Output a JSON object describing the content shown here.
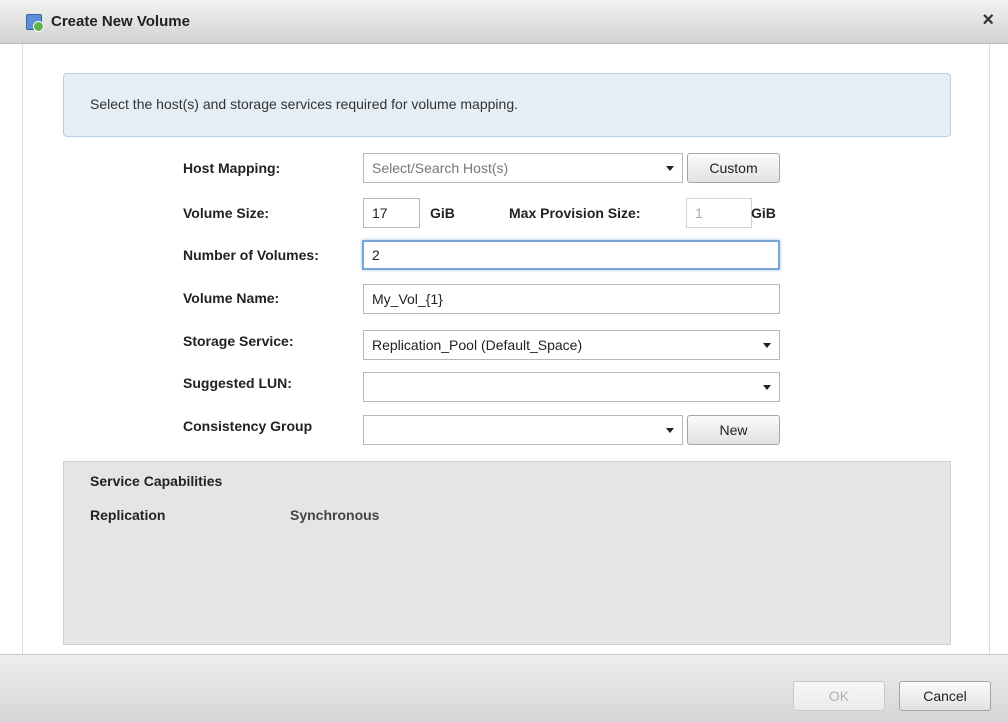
{
  "window": {
    "title": "Create New Volume",
    "close_symbol": "×",
    "title_icon": "create-volume-icon"
  },
  "info": {
    "text": "Select the host(s) and storage services required for volume mapping."
  },
  "form": {
    "host_mapping": {
      "label": "Host Mapping:",
      "placeholder": "Select/Search  Host(s)",
      "custom_label": "Custom"
    },
    "volume_size": {
      "label": "Volume Size:",
      "value": "17",
      "unit": "GiB",
      "max_label": "Max Provision Size:",
      "max_value": "1",
      "max_unit": "GiB"
    },
    "number_of_volumes": {
      "label": "Number of Volumes:",
      "value": "2"
    },
    "volume_name": {
      "label": "Volume Name:",
      "value": "My_Vol_{1}"
    },
    "storage_service": {
      "label": "Storage Service:",
      "value": "Replication_Pool (Default_Space)"
    },
    "suggested_lun": {
      "label": "Suggested LUN:",
      "value": ""
    },
    "consistency_group": {
      "label": "Consistency Group",
      "value": "",
      "new_label": "New"
    }
  },
  "capabilities": {
    "title": "Service Capabilities",
    "items": [
      {
        "key": "Replication",
        "value": "Synchronous"
      }
    ]
  },
  "footer": {
    "ok_label": "OK",
    "cancel_label": "Cancel"
  },
  "colors": {
    "info_bg": "#e6eef5",
    "panel_bg": "#e5e5e5",
    "focus_border": "#7aa6d6"
  }
}
